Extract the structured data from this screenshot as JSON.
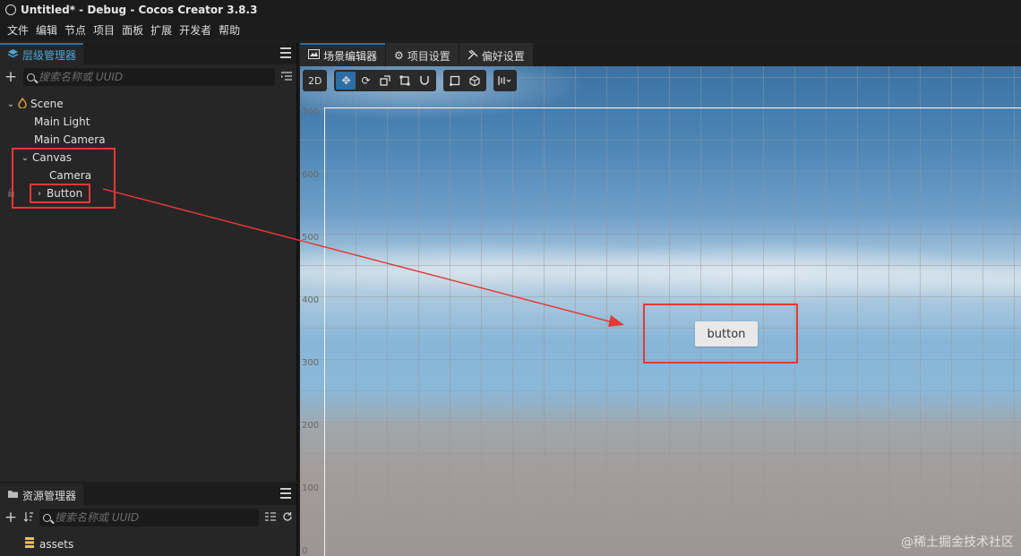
{
  "window": {
    "title": "Untitled* - Debug - Cocos Creator 3.8.3"
  },
  "menu": [
    "文件",
    "编辑",
    "节点",
    "项目",
    "面板",
    "扩展",
    "开发者",
    "帮助"
  ],
  "hierarchy": {
    "tab_label": "层级管理器",
    "search_placeholder": "搜索名称或 UUID",
    "tree": {
      "scene": "Scene",
      "main_light": "Main Light",
      "main_camera": "Main Camera",
      "canvas": "Canvas",
      "camera": "Camera",
      "button": "Button"
    }
  },
  "assets_panel": {
    "tab_label": "资源管理器",
    "search_placeholder": "搜索名称或 UUID",
    "root": "assets"
  },
  "scene_tabs": [
    "场景编辑器",
    "项目设置",
    "偏好设置"
  ],
  "scene_toolbar": {
    "mode_2d": "2D"
  },
  "viewport": {
    "y_axis_labels": [
      "700",
      "600",
      "500",
      "400",
      "300",
      "200",
      "100",
      "0"
    ],
    "button_text": "button"
  },
  "watermark": "@稀土掘金技术社区",
  "colors": {
    "accent": "#2e6ea6",
    "annotation": "#e53935",
    "hierarchy_tab": "#4aa8d8"
  }
}
